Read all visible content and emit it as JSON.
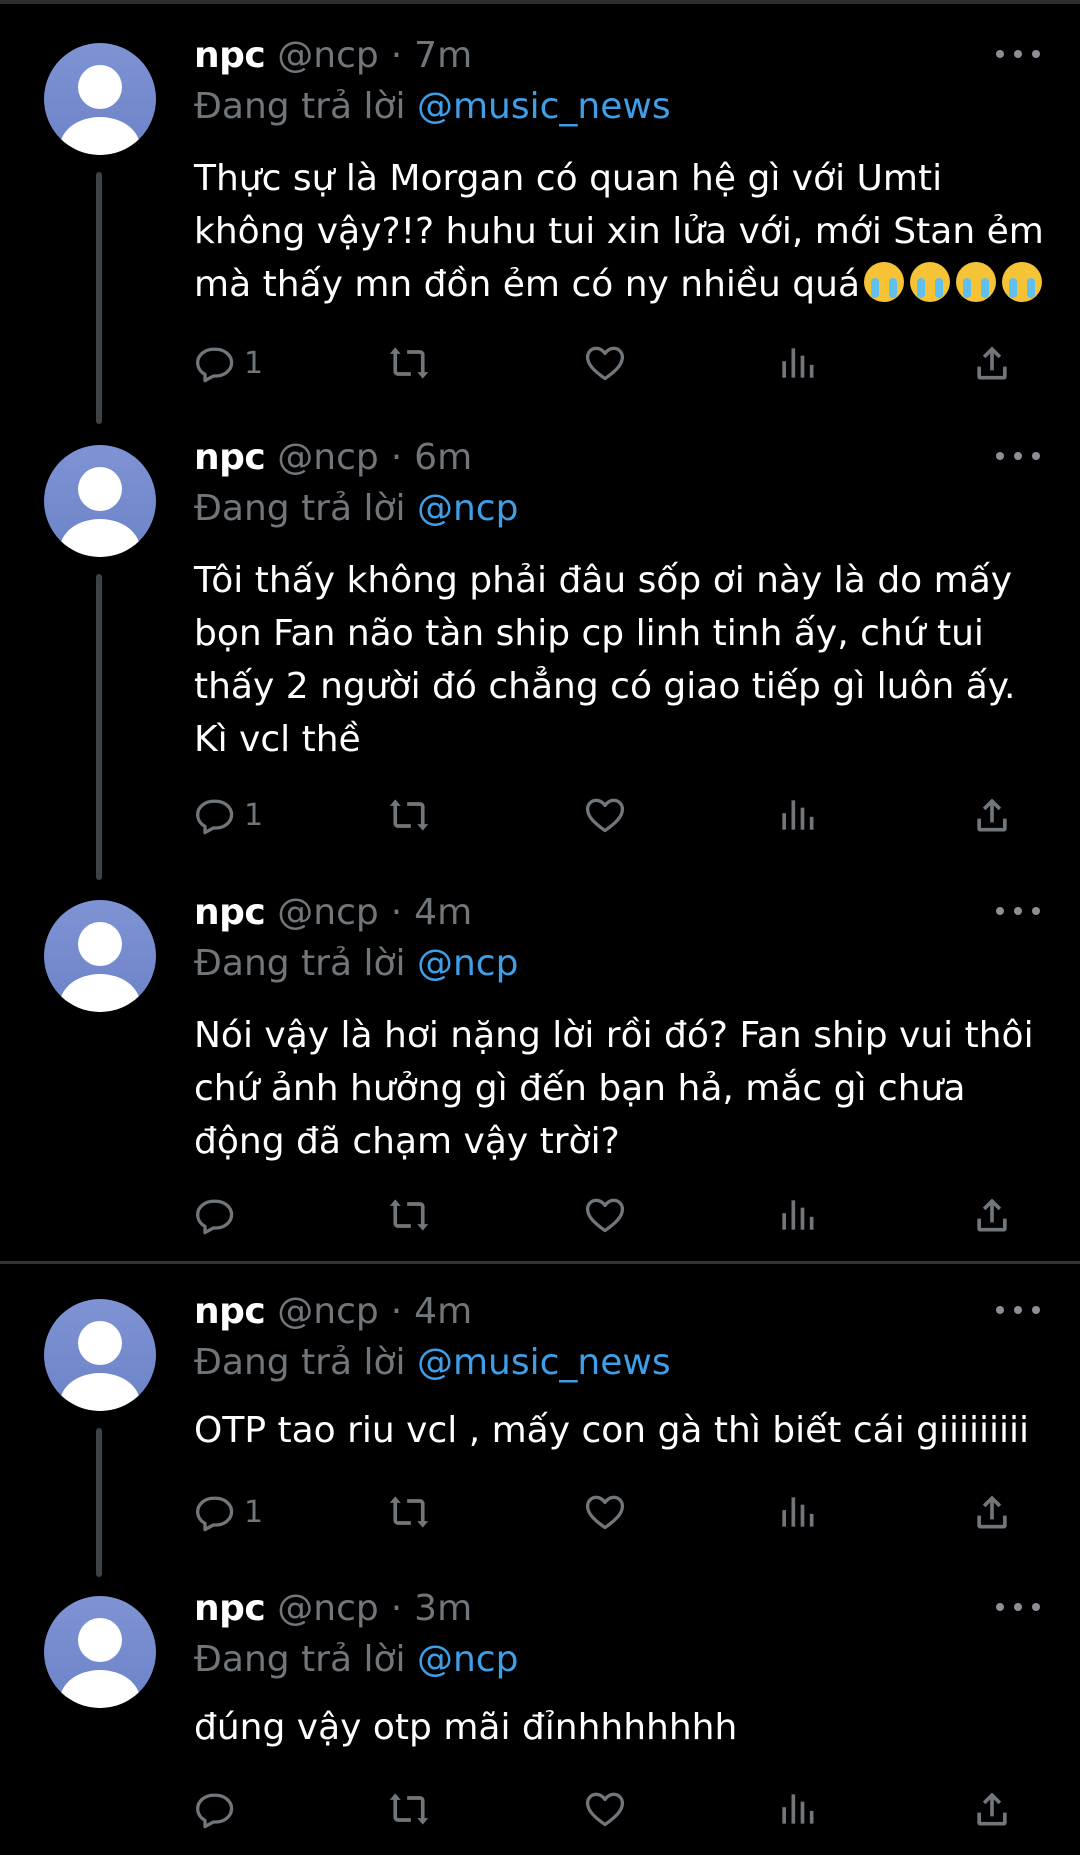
{
  "colors": {
    "background": "#000000",
    "text": "#ffffff",
    "muted": "#71767b",
    "link": "#3f9ee6",
    "avatar": "#7689cd",
    "divider": "#2f3336"
  },
  "icons": {
    "reply": "reply-icon",
    "retweet": "retweet-icon",
    "like": "heart-icon",
    "views": "views-icon",
    "share": "share-icon",
    "more": "more-options-icon",
    "avatar": "default-avatar-icon",
    "emoji": "loudly-crying-face-emoji"
  },
  "replying_prefix": "Đang trả lời",
  "tweets": [
    {
      "name": "npc",
      "handle": "@ncp",
      "time": "7m",
      "reply_to": "@music_news",
      "text": "Thực sự là Morgan có quan hệ gì với Umti\nkhông vậy?!? huhu tui xin lửa với, mới Stan ẻm\nmà thấy mn đồn ẻm có ny nhiều quá",
      "emoji": "😭😭😭😭",
      "reply_count": "1"
    },
    {
      "name": "npc",
      "handle": "@ncp",
      "time": "6m",
      "reply_to": "@ncp",
      "text": "Tôi thấy không phải đâu sốp ơi này là do mấy\nbọn Fan não tàn ship cp linh tinh ấy, chứ tui\nthấy 2 người đó chẳng có giao tiếp gì luôn ấy.\nKì vcl thề",
      "reply_count": "1"
    },
    {
      "name": "npc",
      "handle": "@ncp",
      "time": "4m",
      "reply_to": "@ncp",
      "text": "Nói vậy là hơi nặng lời rồi đó? Fan ship vui thôi\nchứ ảnh hưởng gì đến bạn hả, mắc gì chưa\nđộng đã chạm vậy trời?",
      "reply_count": ""
    },
    {
      "name": "npc",
      "handle": "@ncp",
      "time": "4m",
      "reply_to": "@music_news",
      "text": "OTP tao riu vcl , mấy con gà thì biết cái giiiiiiiii",
      "reply_count": "1"
    },
    {
      "name": "npc",
      "handle": "@ncp",
      "time": "3m",
      "reply_to": "@ncp",
      "text": "đúng vậy otp mãi đỉnhhhhhhh",
      "reply_count": ""
    }
  ]
}
